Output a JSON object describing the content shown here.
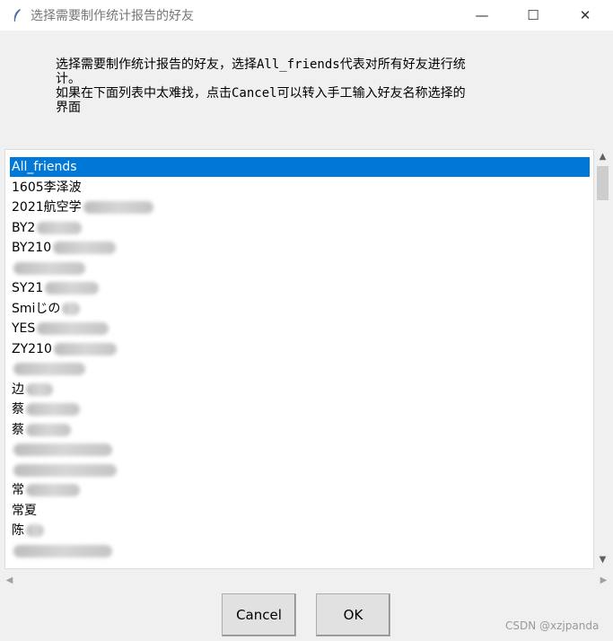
{
  "window": {
    "title": "选择需要制作统计报告的好友",
    "icon": "feather-icon",
    "controls": {
      "minimize": "—",
      "maximize": "☐",
      "close": "✕"
    }
  },
  "message": "选择需要制作统计报告的好友，选择All_friends代表对所有好友进行统\n计。\n如果在下面列表中太难找，点击Cancel可以转入手工输入好友名称选择的\n界面",
  "list": {
    "selected_index": 0,
    "items": [
      {
        "label": "All_friends"
      },
      {
        "label": "1605李泽波"
      },
      {
        "label": "2021航空学"
      },
      {
        "label": "BY2"
      },
      {
        "label": "BY210"
      },
      {
        "label": ""
      },
      {
        "label": "SY21"
      },
      {
        "label": "Smiじの"
      },
      {
        "label": "YES"
      },
      {
        "label": "ZY210"
      },
      {
        "label": ""
      },
      {
        "label": "边"
      },
      {
        "label": "蔡"
      },
      {
        "label": "蔡"
      },
      {
        "label": ""
      },
      {
        "label": ""
      },
      {
        "label": "常"
      },
      {
        "label": "常夏"
      },
      {
        "label": "陈"
      },
      {
        "label": ""
      }
    ]
  },
  "buttons": {
    "cancel": "Cancel",
    "ok": "OK"
  },
  "watermark": "CSDN @xzjpanda",
  "colors": {
    "selection": "#0078d7",
    "background": "#f0f0f0"
  }
}
